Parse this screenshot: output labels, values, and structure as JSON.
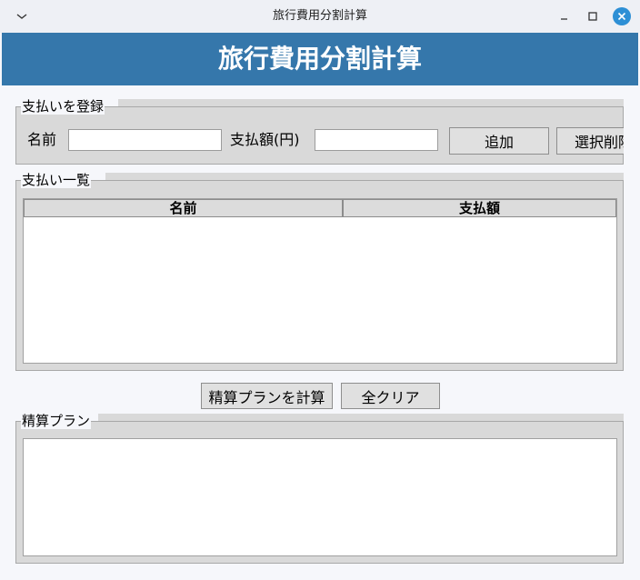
{
  "window": {
    "title": "旅行費用分割計算"
  },
  "header": {
    "title": "旅行費用分割計算"
  },
  "register": {
    "label": "支払いを登録",
    "name_label": "名前",
    "name_value": "",
    "amount_label": "支払額(円)",
    "amount_value": "",
    "add_button": "追加",
    "delete_button": "選択削除"
  },
  "list": {
    "label": "支払い一覧",
    "columns": [
      "名前",
      "支払額"
    ],
    "rows": []
  },
  "actions": {
    "calculate_button": "精算プランを計算",
    "clear_button": "全クリア"
  },
  "plan": {
    "label": "精算プラン",
    "text": ""
  },
  "colors": {
    "banner": "#3577ab",
    "close_button": "#2d8fd5"
  }
}
